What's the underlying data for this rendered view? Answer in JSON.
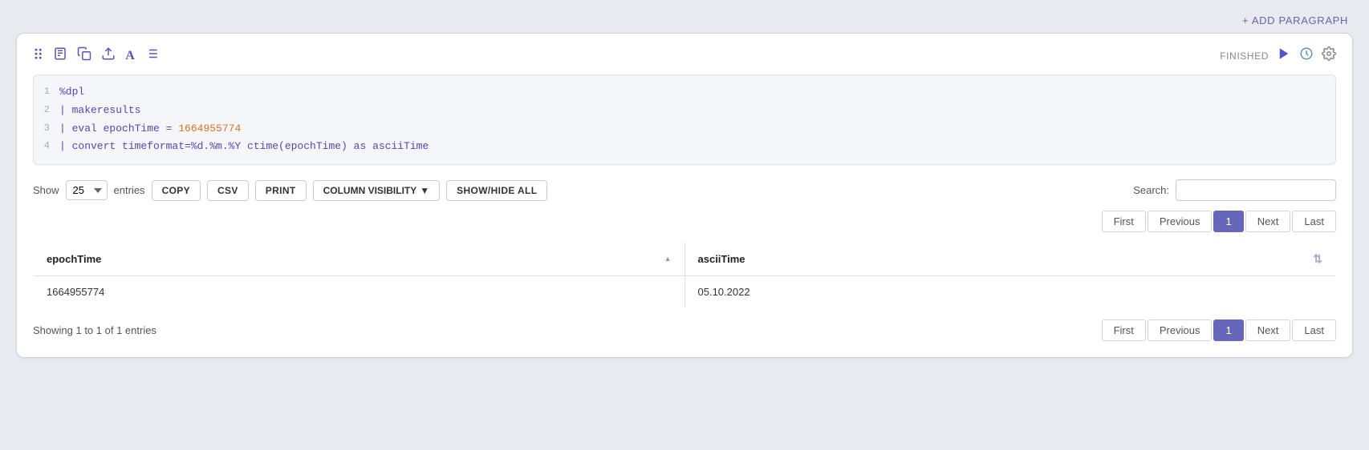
{
  "topbar": {
    "add_paragraph_label": "+ ADD PARAGRAPH"
  },
  "toolbar": {
    "status": "FINISHED",
    "icons": {
      "move": "⠿",
      "file": "📄",
      "copy_file": "📋",
      "upload": "🔺",
      "font": "A",
      "list": "≡"
    }
  },
  "code": {
    "lines": [
      {
        "number": "1",
        "content": "%dpl"
      },
      {
        "number": "2",
        "content": "| makeresults"
      },
      {
        "number": "3",
        "content": "| eval epochTime = 1664955774",
        "has_orange": true,
        "orange_text": "1664955774"
      },
      {
        "number": "4",
        "content": "| convert timeformat=%d.%m.%Y ctime(epochTime) as asciiTime"
      }
    ]
  },
  "table_controls": {
    "show_label": "Show",
    "entries_value": "25",
    "entries_label": "entries",
    "buttons": {
      "copy": "COPY",
      "csv": "CSV",
      "print": "PRINT",
      "column_visibility": "COLUMN VISIBILITY",
      "show_hide_all": "SHOW/HIDE ALL"
    },
    "search_label": "Search:",
    "search_placeholder": ""
  },
  "pagination_top": {
    "first": "First",
    "previous": "Previous",
    "page": "1",
    "next": "Next",
    "last": "Last"
  },
  "table": {
    "columns": [
      {
        "id": "epochTime",
        "label": "epochTime",
        "sortable": true
      },
      {
        "id": "asciiTime",
        "label": "asciiTime",
        "filterable": true
      }
    ],
    "rows": [
      {
        "epochTime": "1664955774",
        "asciiTime": "05.10.2022"
      }
    ]
  },
  "pagination_bottom": {
    "first": "First",
    "previous": "Previous",
    "page": "1",
    "next": "Next",
    "last": "Last"
  },
  "footer": {
    "info": "Showing 1 to 1 of 1 entries"
  }
}
